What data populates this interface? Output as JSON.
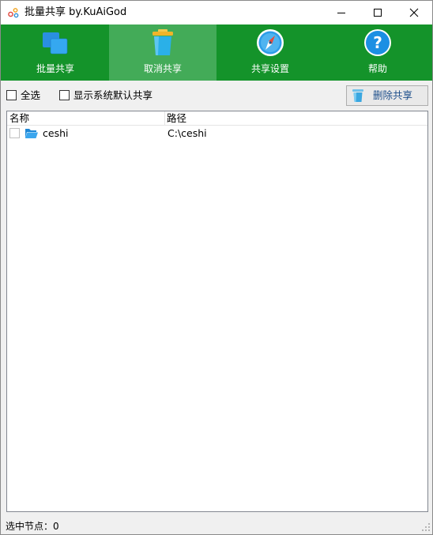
{
  "window": {
    "title": "批量共享 by.KuAiGod"
  },
  "toolbar": {
    "items": [
      {
        "label": "批量共享",
        "icon": "batch-share-icon",
        "active": false
      },
      {
        "label": "取消共享",
        "icon": "trash-icon",
        "active": true
      },
      {
        "label": "共享设置",
        "icon": "compass-icon",
        "active": false
      },
      {
        "label": "帮助",
        "icon": "help-icon",
        "active": false
      }
    ]
  },
  "options": {
    "select_all": "全选",
    "show_default": "显示系统默认共享",
    "delete_button": "删除共享"
  },
  "list": {
    "columns": [
      "名称",
      "路径"
    ],
    "rows": [
      {
        "name": "ceshi",
        "path": "C:\\ceshi",
        "checked": false
      }
    ]
  },
  "status": {
    "text": "选中节点：0"
  },
  "colors": {
    "toolbar_bg": "#14932a",
    "toolbar_active": "#43ab58",
    "delete_label": "#1c4e8a"
  }
}
